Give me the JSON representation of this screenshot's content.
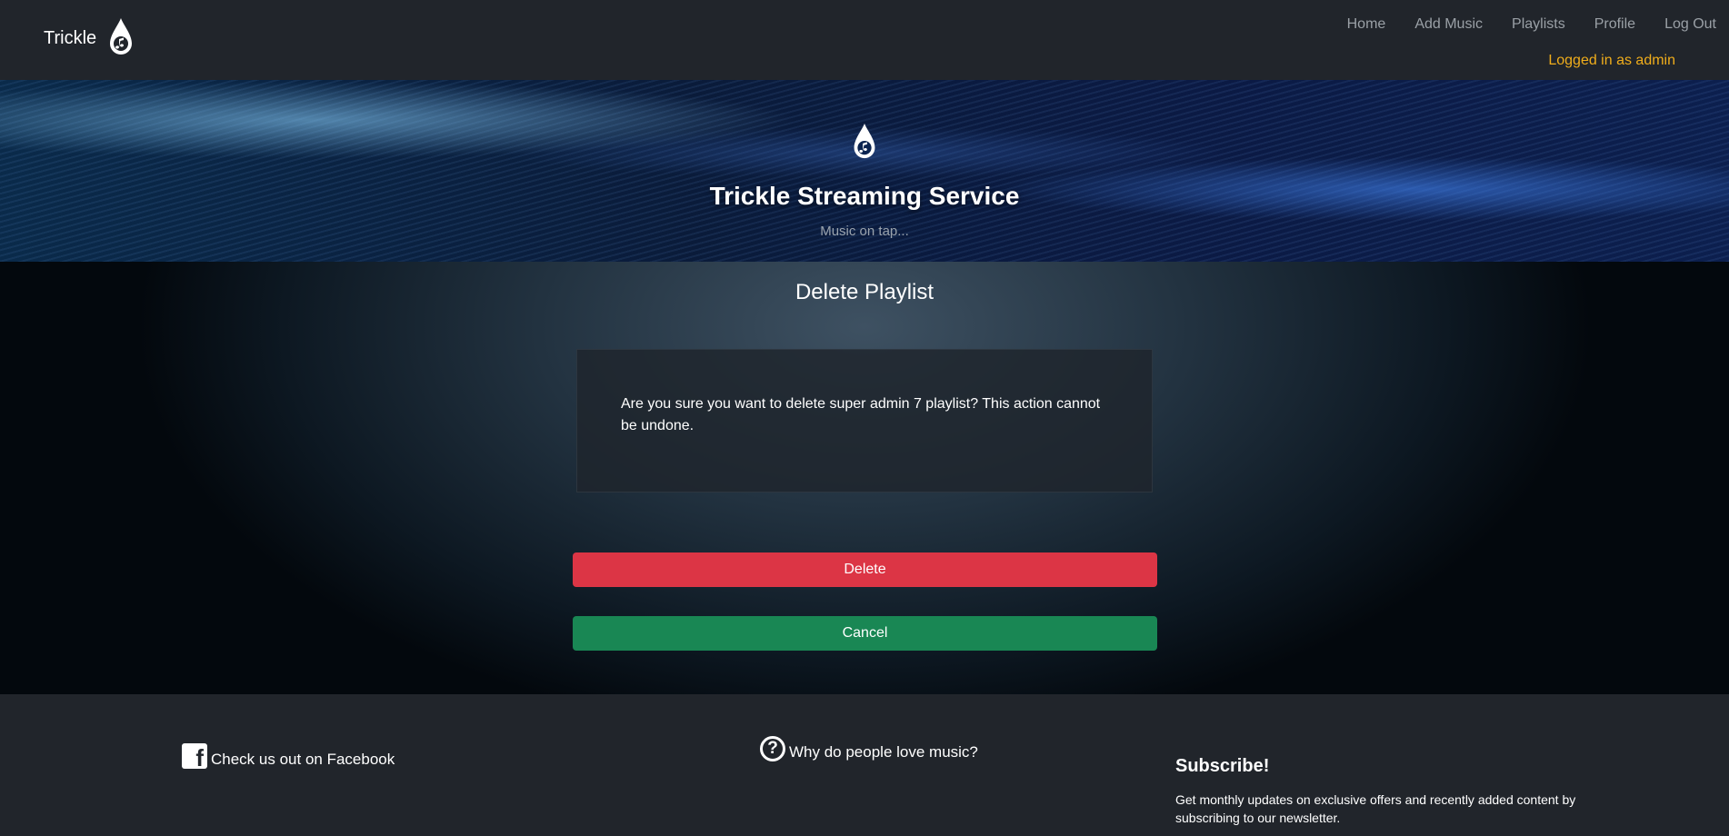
{
  "navbar": {
    "brand": "Trickle",
    "links": [
      {
        "label": "Home"
      },
      {
        "label": "Add Music"
      },
      {
        "label": "Playlists"
      },
      {
        "label": "Profile"
      },
      {
        "label": "Log Out"
      }
    ],
    "login_status": "Logged in as admin"
  },
  "hero": {
    "title": "Trickle Streaming Service",
    "subtitle": "Music on tap..."
  },
  "main": {
    "page_title": "Delete Playlist",
    "confirm_message": "Are you sure you want to delete super admin 7 playlist? This action cannot be undone.",
    "delete_label": "Delete",
    "cancel_label": "Cancel"
  },
  "footer": {
    "facebook_label": "Check us out on Facebook",
    "why_label": "Why do people love music?",
    "subscribe_title": "Subscribe!",
    "subscribe_text": "Get monthly updates on exclusive offers and recently added content by subscribing to our newsletter."
  },
  "colors": {
    "navbar_bg": "#21252b",
    "login_status": "#f0ad1b",
    "delete_button": "#dc3545",
    "cancel_button": "#198754"
  },
  "icons": [
    "water-drop-music-logo",
    "facebook-icon",
    "question-circle-icon"
  ]
}
